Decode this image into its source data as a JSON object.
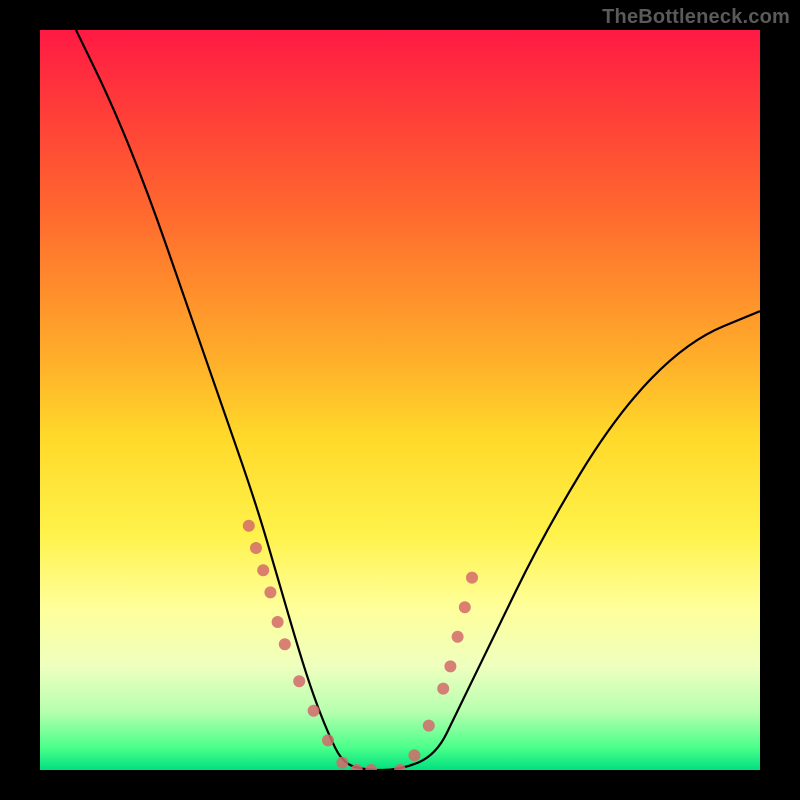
{
  "watermark": "TheBottleneck.com",
  "chart_data": {
    "type": "line",
    "title": "",
    "xlabel": "",
    "ylabel": "",
    "xlim": [
      0,
      100
    ],
    "ylim": [
      0,
      100
    ],
    "gradient_stops": [
      {
        "pct": 0,
        "color": "#ff1a44"
      },
      {
        "pct": 10,
        "color": "#ff3a3a"
      },
      {
        "pct": 25,
        "color": "#ff6a2e"
      },
      {
        "pct": 45,
        "color": "#ffb02a"
      },
      {
        "pct": 55,
        "color": "#ffd92a"
      },
      {
        "pct": 68,
        "color": "#fff24a"
      },
      {
        "pct": 78,
        "color": "#ffff9a"
      },
      {
        "pct": 86,
        "color": "#eeffbe"
      },
      {
        "pct": 92,
        "color": "#b8ffb0"
      },
      {
        "pct": 97,
        "color": "#4aff8a"
      },
      {
        "pct": 100,
        "color": "#00e080"
      }
    ],
    "series": [
      {
        "name": "bottleneck-curve",
        "x": [
          5,
          10,
          15,
          20,
          25,
          30,
          33,
          36,
          38,
          40,
          42,
          45,
          50,
          55,
          58,
          62,
          70,
          80,
          90,
          100
        ],
        "y": [
          100,
          90,
          78,
          64,
          50,
          36,
          26,
          16,
          10,
          5,
          1,
          0,
          0,
          2,
          8,
          16,
          32,
          48,
          58,
          62
        ]
      }
    ],
    "markers": {
      "name": "highlight-dots",
      "color": "#d46a6a",
      "x": [
        29,
        30,
        31,
        32,
        33,
        34,
        36,
        38,
        40,
        42,
        44,
        46,
        50,
        52,
        54,
        56,
        57,
        58,
        59,
        60
      ],
      "y": [
        33,
        30,
        27,
        24,
        20,
        17,
        12,
        8,
        4,
        1,
        0,
        0,
        0,
        2,
        6,
        11,
        14,
        18,
        22,
        26
      ]
    }
  }
}
